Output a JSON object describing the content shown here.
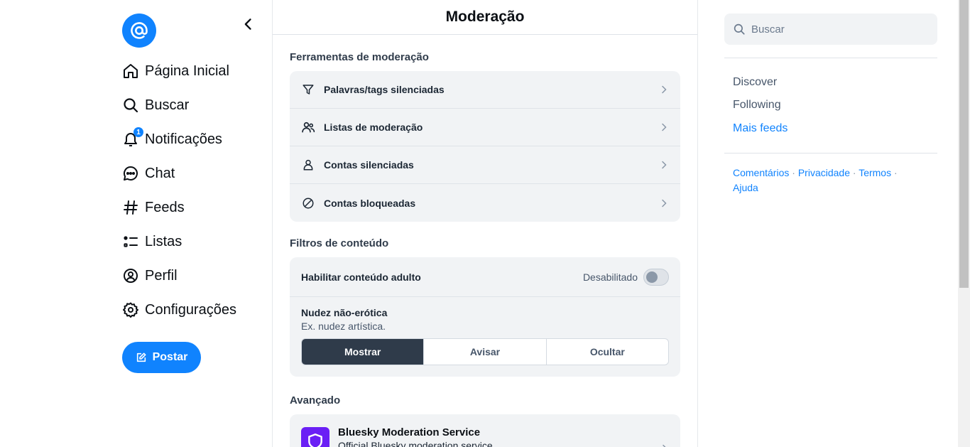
{
  "nav": {
    "logo_icon": "at-sign-icon",
    "items": [
      {
        "label": "Página Inicial",
        "icon": "home-icon"
      },
      {
        "label": "Buscar",
        "icon": "search-icon"
      },
      {
        "label": "Notificações",
        "icon": "bell-icon",
        "badge": "1"
      },
      {
        "label": "Chat",
        "icon": "chat-bubble-icon"
      },
      {
        "label": "Feeds",
        "icon": "hash-icon"
      },
      {
        "label": "Listas",
        "icon": "list-icon"
      },
      {
        "label": "Perfil",
        "icon": "user-circle-icon"
      },
      {
        "label": "Configurações",
        "icon": "gear-icon"
      }
    ],
    "post_label": "Postar"
  },
  "page": {
    "title": "Moderação",
    "tools_title": "Ferramentas de moderação",
    "tools": [
      {
        "label": "Palavras/tags silenciadas",
        "icon": "filter-icon"
      },
      {
        "label": "Listas de moderação",
        "icon": "users-icon"
      },
      {
        "label": "Contas silenciadas",
        "icon": "person-icon"
      },
      {
        "label": "Contas bloqueadas",
        "icon": "block-icon"
      }
    ],
    "filters_title": "Filtros de conteúdo",
    "adult": {
      "label": "Habilitar conteúdo adulto",
      "state": "Desabilitado",
      "enabled": false
    },
    "nudity": {
      "title": "Nudez não-erótica",
      "subtitle": "Ex. nudez artística.",
      "options": [
        "Mostrar",
        "Avisar",
        "Ocultar"
      ],
      "selected": "Mostrar"
    },
    "advanced_title": "Avançado",
    "labeler": {
      "name": "Bluesky Moderation Service",
      "description": "Official Bluesky moderation service",
      "color": "#6a1ff5"
    }
  },
  "sidebar": {
    "search_placeholder": "Buscar",
    "feeds": [
      "Discover",
      "Following"
    ],
    "more_feeds": "Mais feeds",
    "footer": [
      "Comentários",
      "Privacidade",
      "Termos",
      "Ajuda"
    ]
  },
  "colors": {
    "accent": "#1083fe",
    "text": "#0b0f14",
    "muted": "#47566a"
  }
}
